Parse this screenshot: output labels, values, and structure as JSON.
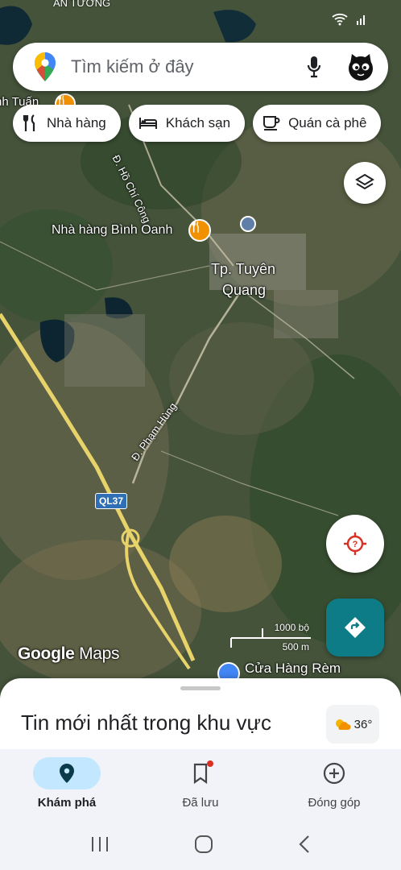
{
  "status": {
    "top_left_text": "AN TƯỜNG"
  },
  "search": {
    "placeholder": "Tìm kiếm ở đây"
  },
  "chips": [
    {
      "label": "Nhà hàng",
      "icon": "fork-knife-icon"
    },
    {
      "label": "Khách sạn",
      "icon": "bed-icon"
    },
    {
      "label": "Quán cà phê",
      "icon": "coffee-cup-icon"
    }
  ],
  "map": {
    "labels": {
      "poi_partial": "nh Tuấn",
      "restaurant": "Nhà hàng Bình Oanh",
      "city_line1": "Tp. Tuyên",
      "city_line2": "Quang",
      "road_chi_cong": "Đ. Hồ Chí Công",
      "road_pham_hung": "Đ. Phạm Hùng",
      "route_shield": "QL37",
      "store": "Cửa Hàng Rèm"
    },
    "scale": {
      "top": "1000 bộ",
      "bottom": "500 m"
    },
    "logo": {
      "google": "Google",
      "maps": "Maps"
    },
    "colors": {
      "primary_road": "#e8d36a",
      "pin_orange": "#f29100",
      "pin_blue": "#4285f4"
    }
  },
  "fab": {
    "layers": "layers-icon",
    "locate": "location-target-icon",
    "directions": "directions-icon",
    "directions_color": "#0e7c86"
  },
  "sheet": {
    "title": "Tin mới nhất trong khu vực",
    "weather_temp": "36°",
    "weather_icon": "sun-cloud-icon"
  },
  "nav": [
    {
      "label": "Khám phá",
      "icon": "explore-pin-icon",
      "active": true
    },
    {
      "label": "Đã lưu",
      "icon": "bookmark-icon",
      "active": false,
      "badge": true
    },
    {
      "label": "Đóng góp",
      "icon": "add-circle-icon",
      "active": false
    }
  ]
}
